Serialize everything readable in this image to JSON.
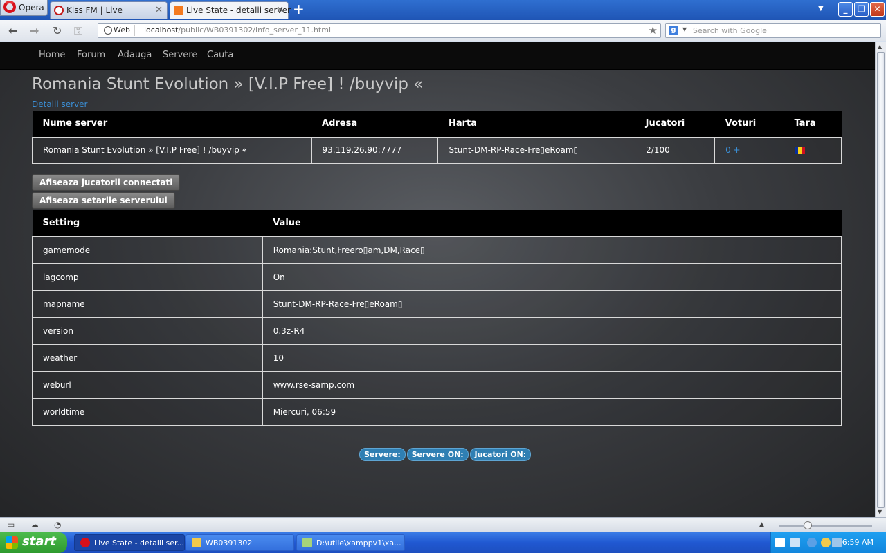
{
  "browser": {
    "menu_label": "Opera",
    "tabs": [
      {
        "title": "Kiss FM | Live",
        "close": "✕"
      },
      {
        "title": "Live State - detalii server",
        "close": "✕"
      }
    ],
    "new_tab": "+",
    "address": {
      "mode": "Web",
      "url_host": "localhost",
      "url_path": "/public/WB0391302/info_server_11.html"
    },
    "search_placeholder": "Search with Google"
  },
  "nav": {
    "items": [
      "Home",
      "Forum",
      "Adauga",
      "Servere",
      "Cauta"
    ]
  },
  "page": {
    "title": "Romania Stunt Evolution » [V.I.P Free] ! /buyvip «",
    "subtitle": "Detalii server"
  },
  "server_table": {
    "headers": [
      "Nume server",
      "Adresa",
      "Harta",
      "Jucatori",
      "Voturi",
      "Tara"
    ],
    "row": {
      "name": "Romania Stunt Evolution » [V.I.P Free] ! /buyvip «",
      "address": "93.119.26.90:7777",
      "map": "Stunt-DM-RP-Race-Fre▯eRoam▯",
      "players": "2/100",
      "votes": "0 +",
      "country": "Romania"
    }
  },
  "buttons": {
    "show_players": "Afiseaza jucatorii connectati",
    "show_settings": "Afiseaza setarile serverului"
  },
  "settings_table": {
    "headers": [
      "Setting",
      "Value"
    ],
    "rows": [
      {
        "setting": "gamemode",
        "value": "Romania:Stunt,Freero▯am,DM,Race▯"
      },
      {
        "setting": "lagcomp",
        "value": "On"
      },
      {
        "setting": "mapname",
        "value": "Stunt-DM-RP-Race-Fre▯eRoam▯"
      },
      {
        "setting": "version",
        "value": "0.3z-R4"
      },
      {
        "setting": "weather",
        "value": "10"
      },
      {
        "setting": "weburl",
        "value": "www.rse-samp.com"
      },
      {
        "setting": "worldtime",
        "value": "Miercuri, 06:59"
      }
    ]
  },
  "footer_stats": {
    "servers": "Servere:",
    "servers_on": "Servere ON:",
    "players_on": "Jucatori ON:"
  },
  "taskbar": {
    "start": "start",
    "tasks": [
      "Live State - detalii ser...",
      "WB0391302",
      "D:\\utile\\xamppv1\\xa..."
    ],
    "clock": "6:59 AM"
  },
  "colors": {
    "link": "#3b8fd6",
    "header_bg": "#000000",
    "nav_bg": "#0b0b0b"
  }
}
